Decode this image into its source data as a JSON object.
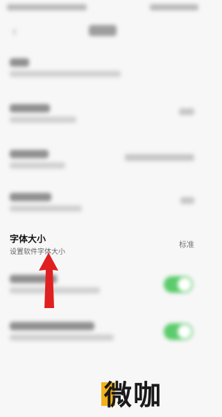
{
  "font_size_row": {
    "title": "字体大小",
    "subtitle": "设置软件字体大小",
    "value": "标准"
  },
  "toggles": [
    {
      "state": "on"
    },
    {
      "state": "on"
    }
  ],
  "colors": {
    "toggle_on": "#5ccb6c",
    "arrow": "#e02020",
    "watermark_accent": "#f3b21b",
    "background": "#f7f7f7"
  },
  "watermark": {
    "text": "微咖"
  },
  "icons": {
    "back": "chevron-left-icon",
    "pointer": "red-arrow-icon"
  }
}
